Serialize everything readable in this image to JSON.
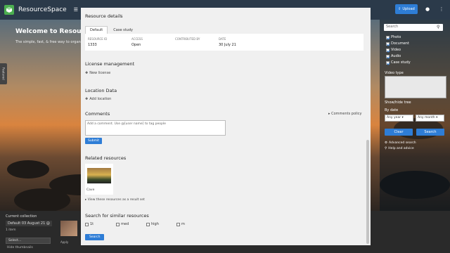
{
  "app": {
    "name": "ResourceSpace",
    "upload_label": "Upload",
    "menu_hint": "☰"
  },
  "hero": {
    "welcome": "Welcome to ResourceS",
    "subtitle": "The simple, fast, & free way to organ"
  },
  "featured_tab": "Featured",
  "collection": {
    "title": "Current collection",
    "name": "Default 03 August 21 @",
    "count": "1 item",
    "select_value": "Select...",
    "hide": "Hide thumbnails",
    "thumb_label": "Apply"
  },
  "search_panel": {
    "placeholder": "Search",
    "resource_types": [
      {
        "label": "Photo",
        "checked": true
      },
      {
        "label": "Document",
        "checked": true
      },
      {
        "label": "Video",
        "checked": true
      },
      {
        "label": "Audio",
        "checked": true
      },
      {
        "label": "Case study",
        "checked": true
      }
    ],
    "video_type_label": "Video type",
    "tree_link": "Show/hide tree",
    "date_label": "By date",
    "year_select": "Any year",
    "month_select": "Any month",
    "clear_label": "Clear",
    "search_label": "Search",
    "advanced_link": "Advanced search",
    "help_link": "Help and advice"
  },
  "modal": {
    "resource_details_title": "Resource details",
    "tabs": [
      "Default",
      "Case study"
    ],
    "details": [
      {
        "header": "RESOURCE ID",
        "value": "1333"
      },
      {
        "header": "ACCESS",
        "value": "Open"
      },
      {
        "header": "CONTRIBUTED BY",
        "value": ""
      },
      {
        "header": "DATE",
        "value": "30 July 21"
      }
    ],
    "license_title": "License management",
    "license_link": "New license",
    "location_title": "Location Data",
    "location_link": "Add location",
    "comments_title": "Comments",
    "comments_policy": "Comments policy",
    "comment_placeholder": "Add a comment. Use @[user name] to tag people",
    "submit_label": "Submit",
    "related_title": "Related resources",
    "related_item": "Cave",
    "view_link": "View these resources as a result set",
    "similar_title": "Search for similar resources",
    "similar_options": [
      "1t",
      "med",
      "high",
      "m"
    ],
    "search_button": "Search"
  }
}
